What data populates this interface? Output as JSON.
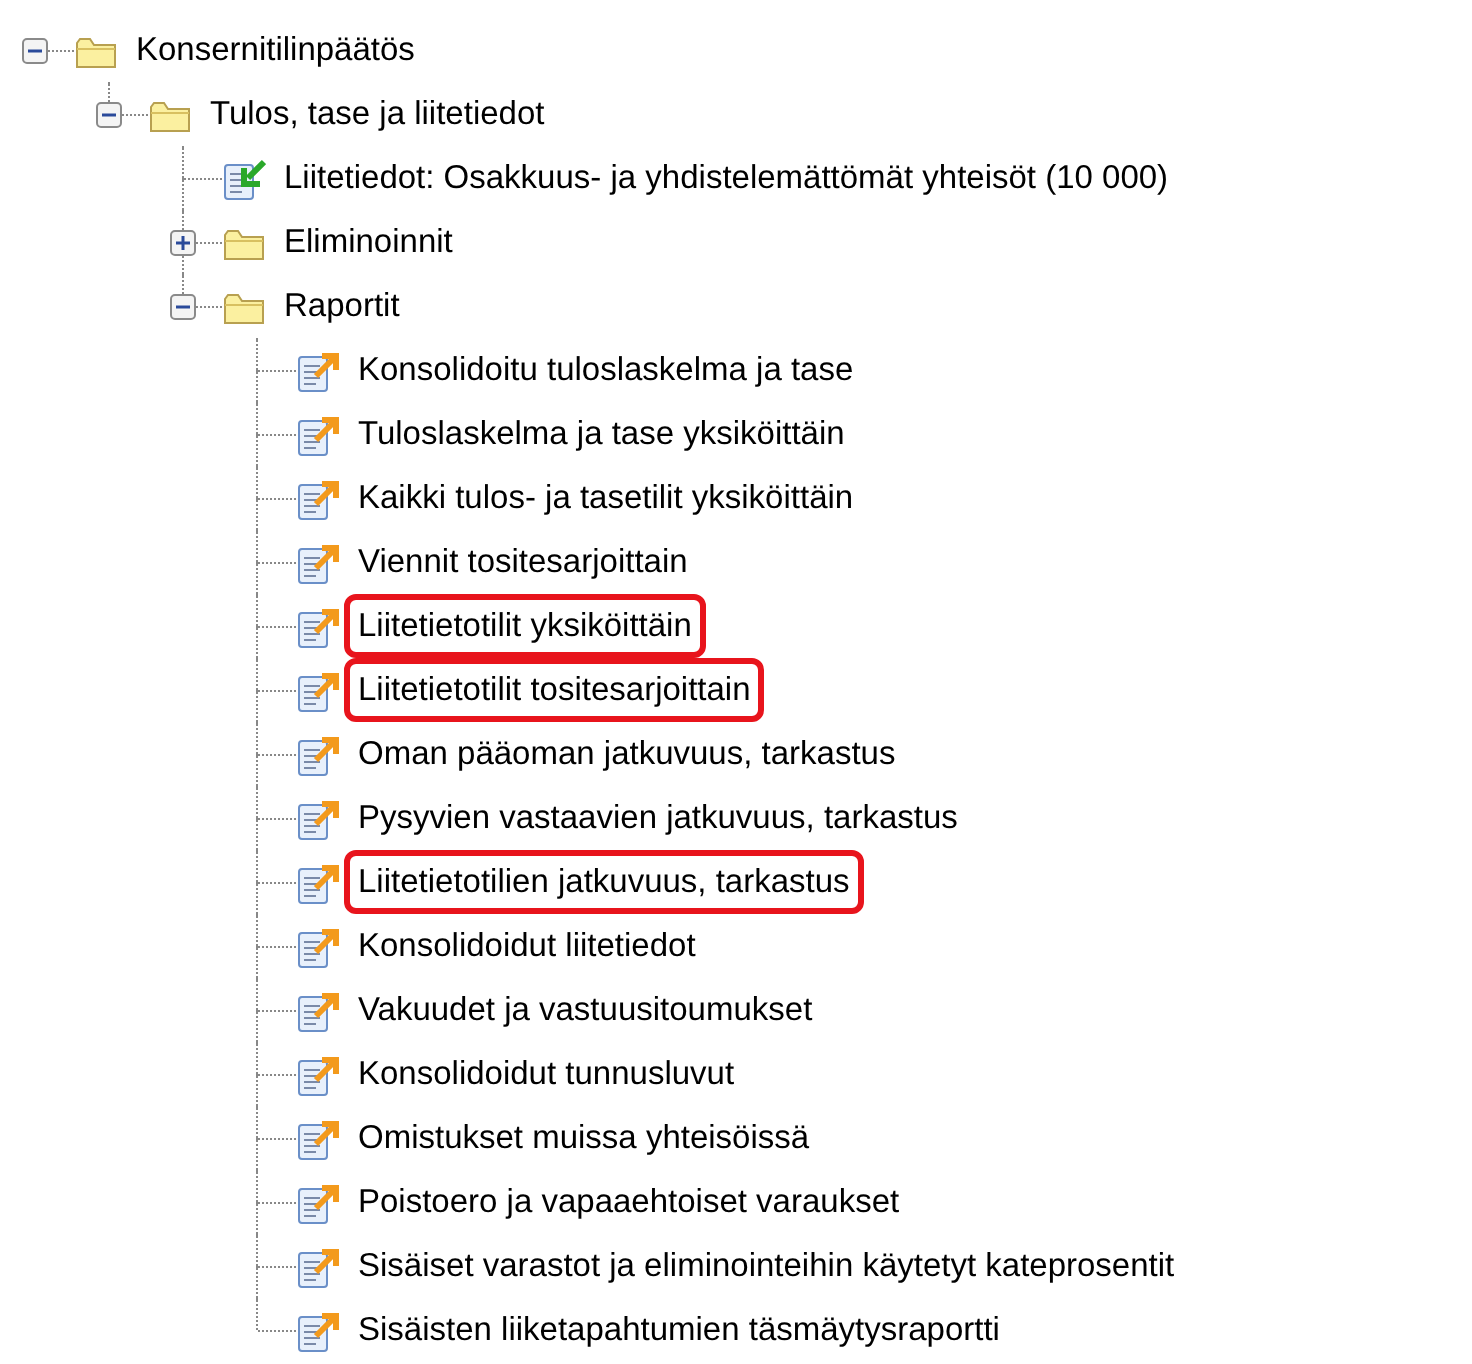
{
  "tree": [
    {
      "label": "Konsernitilinpäätös",
      "kind": "folder",
      "expanded": true,
      "children": [
        {
          "label": "Tulos, tase ja liitetiedot",
          "kind": "folder",
          "expanded": true,
          "children": [
            {
              "label": "Liitetiedot: Osakkuus- ja yhdistelemättömät yhteisöt (10 000)",
              "kind": "import",
              "highlighted": false
            },
            {
              "label": "Eliminoinnit",
              "kind": "folder",
              "expanded": false
            },
            {
              "label": "Raportit",
              "kind": "folder",
              "expanded": true,
              "children": [
                {
                  "label": "Konsolidoitu tuloslaskelma ja tase",
                  "kind": "report",
                  "highlighted": false
                },
                {
                  "label": "Tuloslaskelma ja tase yksiköittäin",
                  "kind": "report",
                  "highlighted": false
                },
                {
                  "label": "Kaikki tulos- ja tasetilit yksiköittäin",
                  "kind": "report",
                  "highlighted": false
                },
                {
                  "label": "Viennit tositesarjoittain",
                  "kind": "report",
                  "highlighted": false
                },
                {
                  "label": "Liitetietotilit yksiköittäin",
                  "kind": "report",
                  "highlighted": true
                },
                {
                  "label": "Liitetietotilit tositesarjoittain",
                  "kind": "report",
                  "highlighted": true
                },
                {
                  "label": "Oman pääoman jatkuvuus, tarkastus",
                  "kind": "report",
                  "highlighted": false
                },
                {
                  "label": "Pysyvien vastaavien jatkuvuus, tarkastus",
                  "kind": "report",
                  "highlighted": false
                },
                {
                  "label": "Liitetietotilien jatkuvuus, tarkastus",
                  "kind": "report",
                  "highlighted": true
                },
                {
                  "label": "Konsolidoidut liitetiedot",
                  "kind": "report",
                  "highlighted": false
                },
                {
                  "label": "Vakuudet ja vastuusitoumukset",
                  "kind": "report",
                  "highlighted": false
                },
                {
                  "label": "Konsolidoidut tunnusluvut",
                  "kind": "report",
                  "highlighted": false
                },
                {
                  "label": "Omistukset muissa yhteisöissä",
                  "kind": "report",
                  "highlighted": false
                },
                {
                  "label": "Poistoero ja vapaaehtoiset varaukset",
                  "kind": "report",
                  "highlighted": false
                },
                {
                  "label": "Sisäiset varastot ja eliminointeihin käytetyt kateprosentit",
                  "kind": "report",
                  "highlighted": false
                },
                {
                  "label": "Sisäisten liiketapahtumien täsmäytysraportti",
                  "kind": "report",
                  "highlighted": false
                }
              ]
            }
          ]
        }
      ]
    }
  ]
}
